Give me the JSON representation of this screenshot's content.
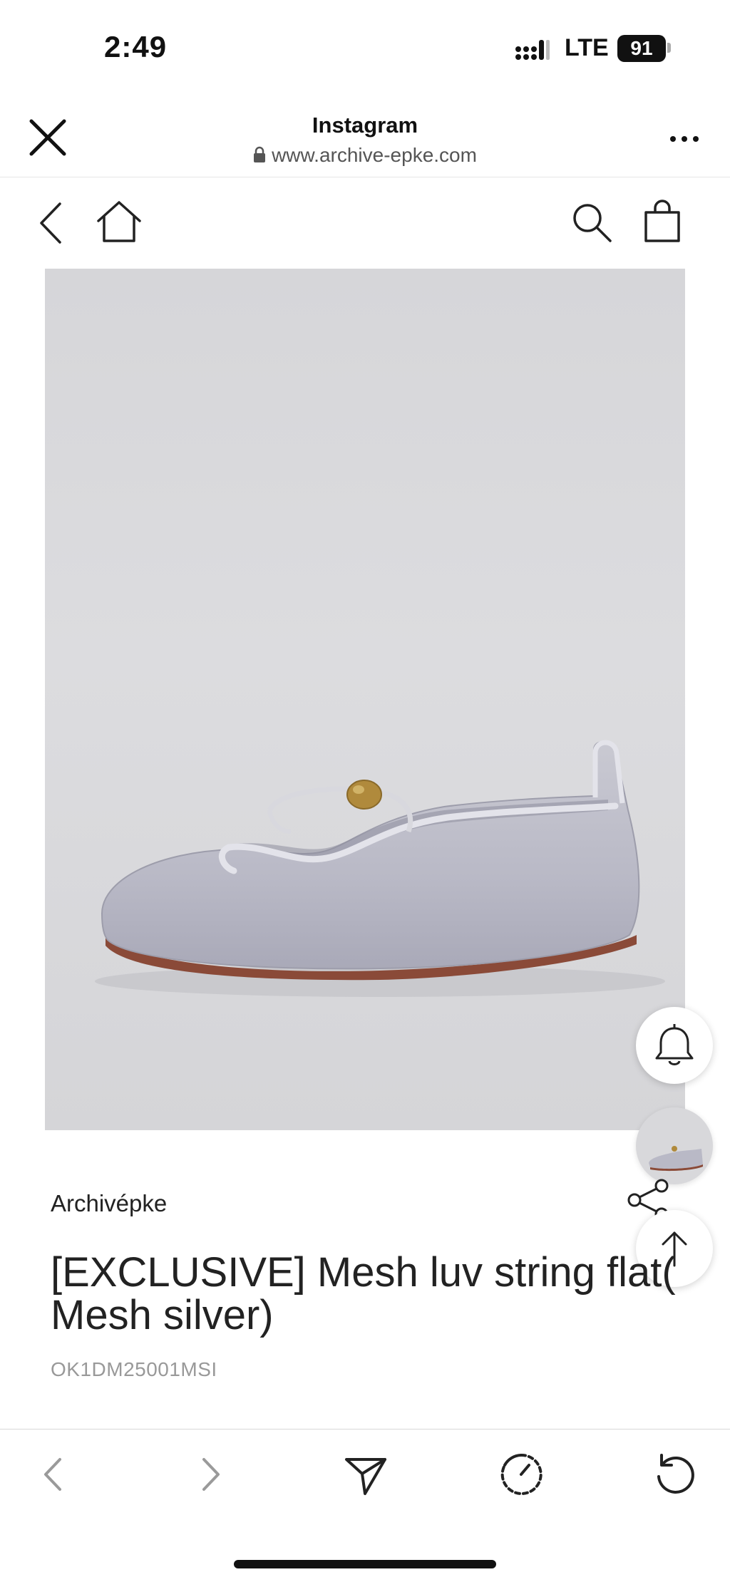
{
  "status_bar": {
    "time": "2:49",
    "network": "LTE",
    "battery": "91"
  },
  "browser": {
    "title": "Instagram",
    "url": "www.archive-epke.com"
  },
  "product": {
    "brand": "Archivépke",
    "name": "[EXCLUSIVE] Mesh luv string flat( Mesh silver)",
    "sku": "OK1DM25001MSI"
  },
  "icons": {
    "close": "close-icon",
    "more": "more-icon",
    "back": "chevron-left-icon",
    "home": "home-icon",
    "search": "search-icon",
    "bag": "shopping-bag-icon",
    "bell": "bell-icon",
    "share": "share-icon",
    "scroll_top": "arrow-up-icon",
    "send": "send-icon",
    "history": "history-icon",
    "reload": "reload-icon"
  },
  "colors": {
    "background": "#ffffff",
    "image_background": "#d8d8db",
    "text": "#222222",
    "muted": "#999999"
  }
}
